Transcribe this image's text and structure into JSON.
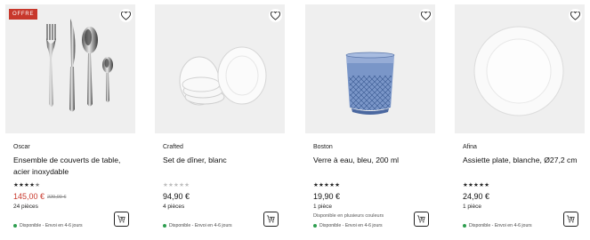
{
  "products": [
    {
      "badge": "OFFRE",
      "collection": "Oscar",
      "title": "Ensemble de couverts de table, acier inoxydable",
      "rating": 4.5,
      "price": "145,00 €",
      "old_price": "229,00 €",
      "pieces": "24 pièces",
      "extra": "",
      "availability": "Disponible - Envoi en 4-6 jours",
      "image_icon": "cutlery-icon"
    },
    {
      "badge": "",
      "collection": "Crafted",
      "title": "Set de dîner, blanc",
      "rating": 0,
      "price": "94,90 €",
      "old_price": "",
      "pieces": "4 pièces",
      "extra": "",
      "availability": "Disponible - Envoi en 4-6 jours",
      "image_icon": "plates-stack-icon"
    },
    {
      "badge": "",
      "collection": "Boston",
      "title": "Verre à eau, bleu, 200 ml",
      "rating": 5,
      "price": "19,90 €",
      "old_price": "",
      "pieces": "1 pièce",
      "extra": "Disponible en plusieurs couleurs",
      "availability": "Disponible - Envoi en 4-6 jours",
      "image_icon": "blue-glass-icon"
    },
    {
      "badge": "",
      "collection": "Afina",
      "title": "Assiette plate, blanche, Ø27,2 cm",
      "rating": 5,
      "price": "24,90 €",
      "old_price": "",
      "pieces": "1 pièce",
      "extra": "",
      "availability": "Disponible - Envoi en 4-6 jours",
      "image_icon": "flat-plate-icon"
    }
  ],
  "colors": {
    "sale": "#c8382c",
    "available": "#2e9e4f",
    "image_bg": "#efefef"
  }
}
